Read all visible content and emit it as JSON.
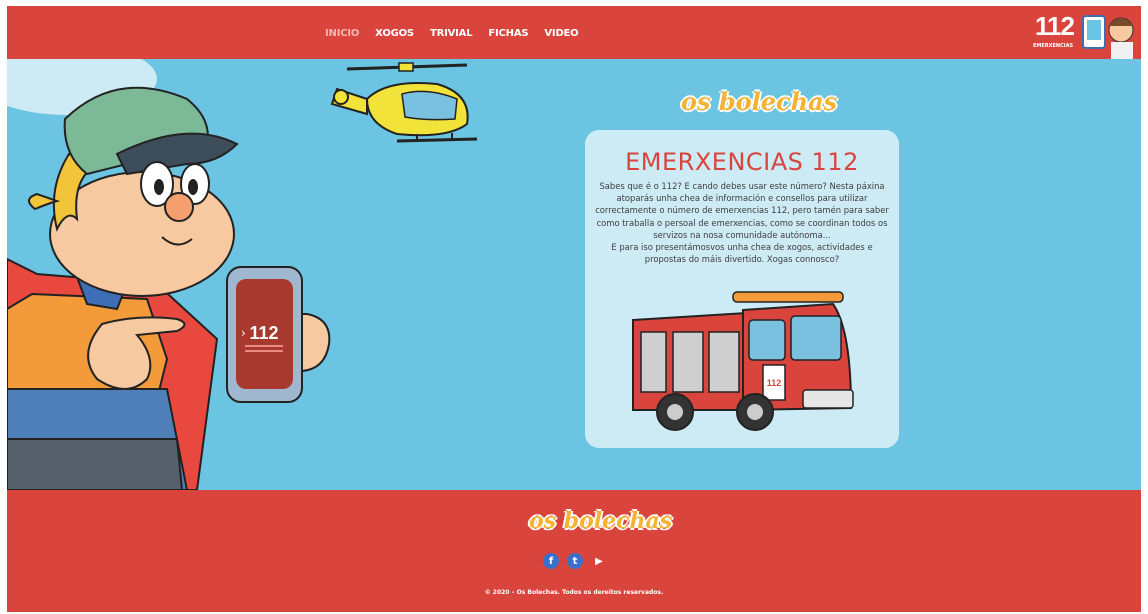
{
  "nav": {
    "items": [
      {
        "label": "INICIO",
        "active": true
      },
      {
        "label": "XOGOS",
        "active": false
      },
      {
        "label": "TRIVIAL",
        "active": false
      },
      {
        "label": "FICHAS",
        "active": false
      },
      {
        "label": "VIDEO",
        "active": false
      }
    ]
  },
  "header_logo": {
    "number": "112",
    "subtitle": "EMERXENCIAS"
  },
  "brand": {
    "name": "os bolechas"
  },
  "card": {
    "title": "EMERXENCIAS 112",
    "paragraph1": "Sabes que é o 112? E cando debes usar este número? Nesta páxina atoparás unha chea de información e consellos para utilizar correctamente o número de emerxencias 112, pero tamén para saber como traballa o persoal de emerxencias, como se coordinan todos os servizos na nosa comunidade autónoma...",
    "paragraph2": "E para iso presentámosvos unha chea de xogos, actividades e propostas do máis divertido. Xogas connosco?"
  },
  "illustrations": {
    "phone_number": "112",
    "truck_number": "112",
    "helicopter": "helicopter-illustration",
    "character": "bolecha-character-illustration"
  },
  "footer": {
    "brand": "os bolechas",
    "socials": [
      {
        "name": "facebook-icon",
        "glyph": "f"
      },
      {
        "name": "twitter-icon",
        "glyph": "t"
      },
      {
        "name": "youtube-icon",
        "glyph": "▶"
      }
    ],
    "copyright": "© 2020 – Os Bolechas. Todos os dereitos reservados."
  },
  "colors": {
    "header_red": "#d9443d",
    "main_blue": "#6bc4e2",
    "card_bg": "#cdebf5",
    "brand_yellow": "#f5b331"
  }
}
